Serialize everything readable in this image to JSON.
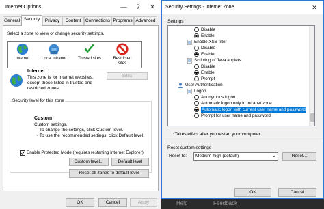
{
  "internet_options": {
    "title": "Internet Options",
    "minimize": "—",
    "help": "?",
    "close": "✕",
    "tabs": [
      "General",
      "Security",
      "Privacy",
      "Content",
      "Connections",
      "Programs",
      "Advanced"
    ],
    "select_zone_label": "Select a zone to view or change security settings.",
    "zones": [
      {
        "label": "Internet",
        "icon": "globe-icon"
      },
      {
        "label": "Local intranet",
        "icon": "local-intranet-icon"
      },
      {
        "label": "Trusted sites",
        "icon": "checkmark-icon"
      },
      {
        "label": "Restricted sites",
        "icon": "restricted-icon"
      }
    ],
    "zone_title": "Internet",
    "zone_description": "This zone is for Internet websites, except those listed in trusted and restricted zones.",
    "sites_button": "Sites",
    "security_level_label": "Security level for this zone",
    "custom_title": "Custom",
    "custom_lines": [
      "Custom settings.",
      "- To change the settings, click Custom level.",
      "- To use the recommended settings, click Default level."
    ],
    "protected_mode_label": "Enable Protected Mode (requires restarting Internet Explorer)",
    "protected_mode_checked": true,
    "custom_level_button": "Custom level...",
    "default_level_button": "Default level",
    "reset_all_button": "Reset all zones to default level",
    "ok_button": "OK",
    "cancel_button": "Cancel",
    "apply_button": "Apply"
  },
  "security_settings": {
    "title": "Security Settings - Internet Zone",
    "close": "✕",
    "settings_label": "Settings",
    "rows": [
      {
        "kind": "radio",
        "label": "Disable",
        "checked": false
      },
      {
        "kind": "radio",
        "label": "Enable",
        "checked": true
      },
      {
        "kind": "header",
        "label": "Enable XSS filter"
      },
      {
        "kind": "radio",
        "label": "Disable",
        "checked": false
      },
      {
        "kind": "radio",
        "label": "Enable",
        "checked": true
      },
      {
        "kind": "header",
        "label": "Scripting of Java applets"
      },
      {
        "kind": "radio",
        "label": "Disable",
        "checked": false
      },
      {
        "kind": "radio",
        "label": "Enable",
        "checked": true
      },
      {
        "kind": "radio",
        "label": "Prompt",
        "checked": false
      },
      {
        "kind": "category",
        "label": "User Authentication"
      },
      {
        "kind": "header",
        "label": "Logon"
      },
      {
        "kind": "radio",
        "label": "Anonymous logon",
        "checked": false
      },
      {
        "kind": "radio",
        "label": "Automatic logon only in Intranet zone",
        "checked": false
      },
      {
        "kind": "radio",
        "label": "Automatic logon with current user name and password",
        "checked": true,
        "selected": true
      },
      {
        "kind": "radio",
        "label": "Prompt for user name and password",
        "checked": false
      }
    ],
    "restart_note": "*Takes effect after you restart your computer",
    "reset_custom_label": "Reset custom settings",
    "reset_to_label": "Reset to:",
    "reset_to_value": "Medium-high (default)",
    "reset_button": "Reset...",
    "ok_button": "OK",
    "cancel_button": "Cancel"
  },
  "background_strip": {
    "help": "Help",
    "feedback": "Feedback"
  }
}
